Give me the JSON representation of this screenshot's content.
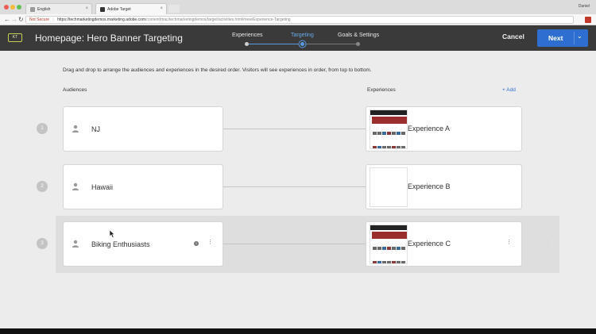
{
  "browser": {
    "tabs": [
      {
        "label": "English",
        "active": false
      },
      {
        "label": "Adobe Target",
        "active": true
      }
    ],
    "user": "Daniel",
    "address": {
      "security_label": "Not Secure",
      "separator": "|",
      "url_host": "https://techmarketingdemos.marketing.adobe.com",
      "url_path": "/content/mac/techmarketingdemos/target/activities.html#new/Experience-Targeting"
    }
  },
  "header": {
    "badge": "KT",
    "title": "Homepage: Hero Banner Targeting",
    "steps": [
      {
        "label": "Experiences",
        "state": "complete"
      },
      {
        "label": "Targeting",
        "state": "current"
      },
      {
        "label": "Goals & Settings",
        "state": "upcoming"
      }
    ],
    "cancel_label": "Cancel",
    "next_label": "Next"
  },
  "content": {
    "instructions": "Drag and drop to arrange the audiences and experiences in the desired order. Visitors will see experiences in order, from top to bottom.",
    "audiences_header": "Audiences",
    "experiences_header": "Experiences",
    "add_label": "+ Add",
    "rows": [
      {
        "number": "1",
        "audience": "NJ",
        "experience": "Experience A",
        "selected": false
      },
      {
        "number": "2",
        "audience": "Hawaii",
        "experience": "Experience B",
        "selected": false
      },
      {
        "number": "3",
        "audience": "Biking Enthusiasts",
        "experience": "Experience C",
        "selected": true
      }
    ]
  },
  "colors": {
    "header_bg": "#3a3a3a",
    "accent_blue": "#2f6ed1",
    "page_bg": "#ececec",
    "card_bg": "#ffffff",
    "kt_badge": "#c8cc55"
  },
  "icons": [
    "person-icon",
    "info-icon",
    "more-vertical-icon",
    "chevron-down-icon",
    "drag-handle-icon"
  ]
}
